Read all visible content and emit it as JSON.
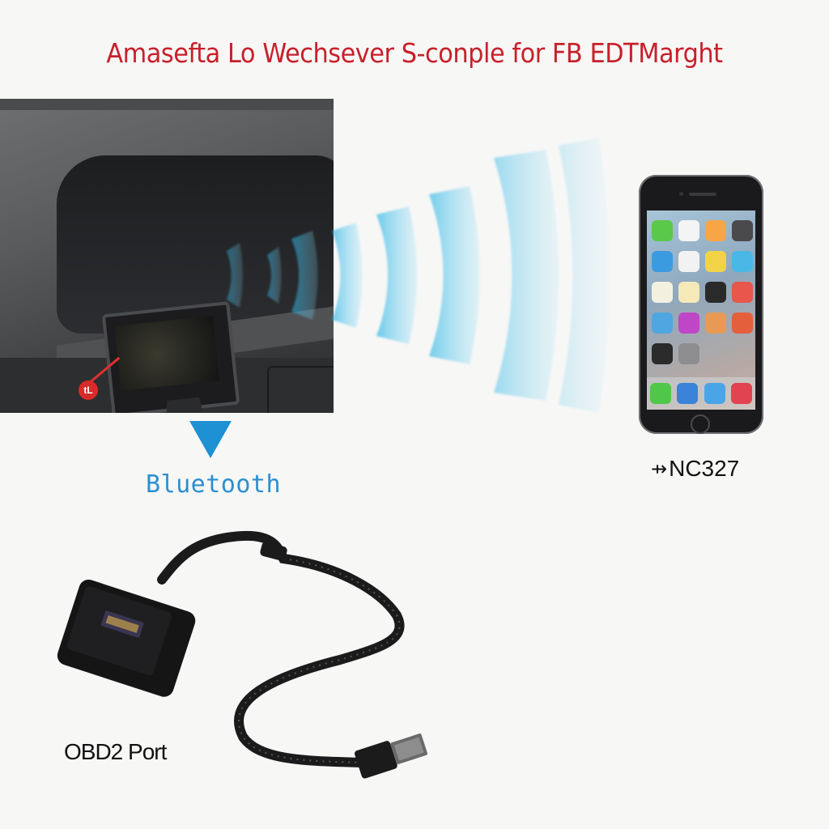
{
  "title": "Amasefta Lo Wechsever S-conple for FB EDTMarght",
  "labels": {
    "bluetooth": "Bluetooth",
    "phone_model": "NC327",
    "phone_symbol": "⇸",
    "obd_port": "OBD2 Port",
    "marker_text": "tL"
  },
  "icons": {
    "arrow": "down-triangle-icon",
    "signal": "bluetooth-signal-waves"
  },
  "colors": {
    "title": "#c8202a",
    "bluetooth_text": "#2a8fd0",
    "arrow": "#1e90d4",
    "wave": "#3fc0ea",
    "marker": "#d92a2a"
  },
  "phone_apps": [
    "#5ac84a",
    "#f4f4f4",
    "#f7a545",
    "#4a4a4c",
    "#3b9be0",
    "#f2f2f2",
    "#f2d347",
    "#4ab8e6",
    "#f4f0e0",
    "#f6e9b8",
    "#2a2a2a",
    "#e9564b",
    "#4fa6e0",
    "#c046c8",
    "#e89a55",
    "#e4603c",
    "#2b2b2b",
    "#8d8d8f"
  ],
  "dock_apps": [
    "#4fc84a",
    "#3a83d8",
    "#4aa5e8",
    "#e24350"
  ]
}
